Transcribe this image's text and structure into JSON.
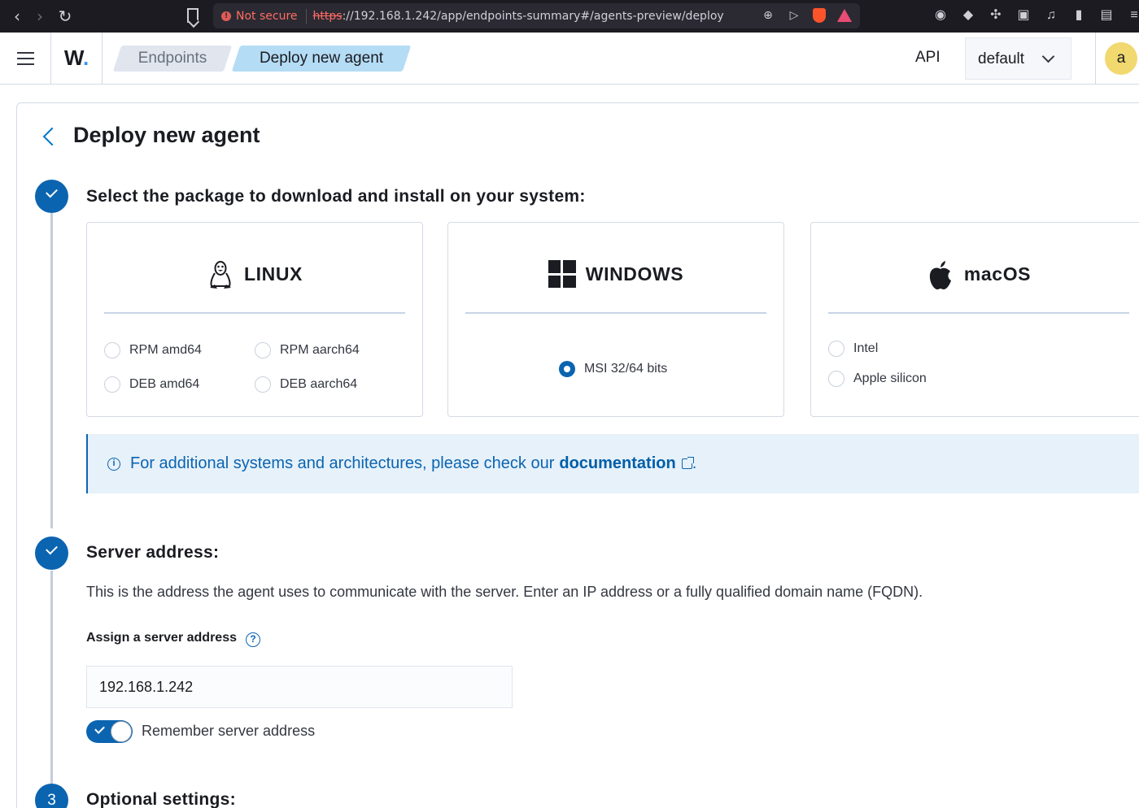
{
  "browser": {
    "not_secure": "Not secure",
    "url_scheme": "https",
    "url_rest": "://192.168.1.242/app/endpoints-summary#/agents-preview/deploy"
  },
  "header": {
    "logo_letter": "W",
    "logo_dot": ".",
    "breadcrumbs": [
      "Endpoints",
      "Deploy new agent"
    ],
    "api_label": "API",
    "space_value": "default",
    "avatar_letter": "a"
  },
  "page": {
    "title": "Deploy new agent"
  },
  "step1": {
    "title": "Select the package to download and install on your system:",
    "linux": {
      "name": "LINUX",
      "options": [
        "RPM amd64",
        "RPM aarch64",
        "DEB amd64",
        "DEB aarch64"
      ]
    },
    "windows": {
      "name": "WINDOWS",
      "options": [
        "MSI 32/64 bits"
      ],
      "selected": "MSI 32/64 bits"
    },
    "macos": {
      "name": "macOS",
      "options": [
        "Intel",
        "Apple silicon"
      ]
    },
    "callout": {
      "text": "For additional systems and architectures, please check our",
      "link": "documentation",
      "suffix": "."
    }
  },
  "step2": {
    "title": "Server address:",
    "description": "This is the address the agent uses to communicate with the server. Enter an IP address or a fully qualified domain name (FQDN).",
    "field_label": "Assign a server address",
    "value": "192.168.1.242",
    "toggle_label": "Remember server address",
    "toggle_on": true
  },
  "step3": {
    "number": "3",
    "title": "Optional settings:"
  },
  "colors": {
    "accent": "#0b64b0",
    "callout_bg": "#e6f1fa",
    "avatar": "#f1d86f"
  }
}
